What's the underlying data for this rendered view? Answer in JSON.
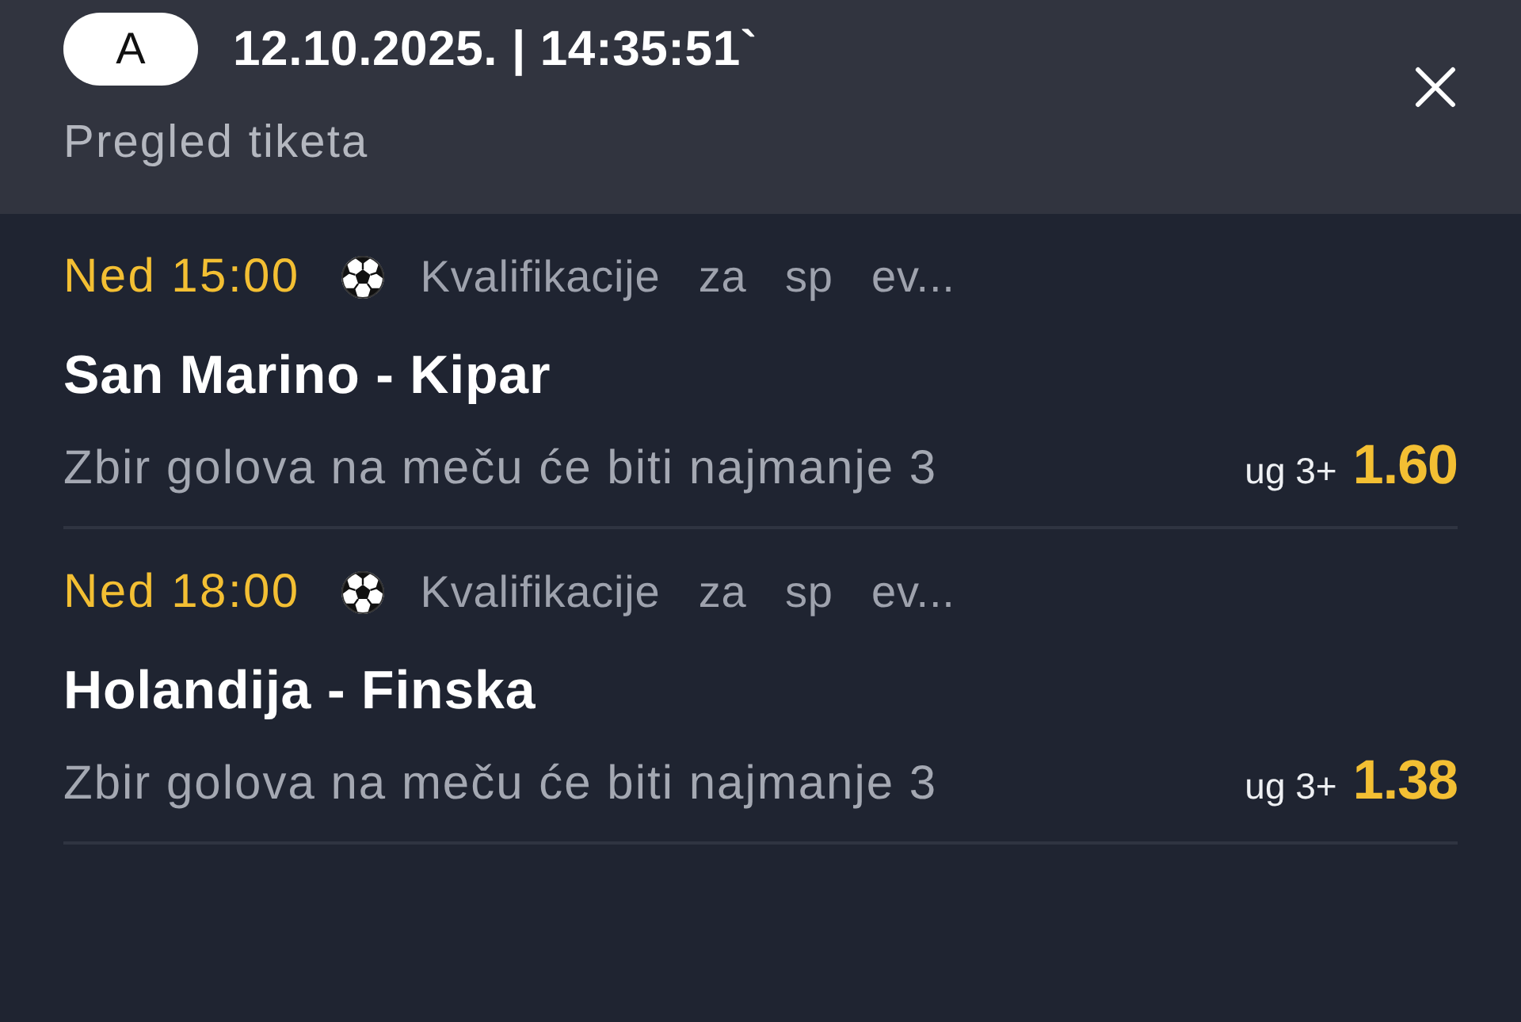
{
  "header": {
    "badge": "A",
    "title": "12.10.2025. | 14:35:51`",
    "subtitle": "Pregled tiketa"
  },
  "bets": [
    {
      "time": "Ned 15:00",
      "league": "Kvalifikacije za sp ev...",
      "match": "San Marino - Kipar",
      "market": "Zbir golova na meču će biti najmanje 3",
      "pick": "ug 3+",
      "odds": "1.60"
    },
    {
      "time": "Ned 18:00",
      "league": "Kvalifikacije za sp ev...",
      "match": "Holandija - Finska",
      "market": "Zbir golova na meču će biti najmanje 3",
      "pick": "ug 3+",
      "odds": "1.38"
    }
  ]
}
